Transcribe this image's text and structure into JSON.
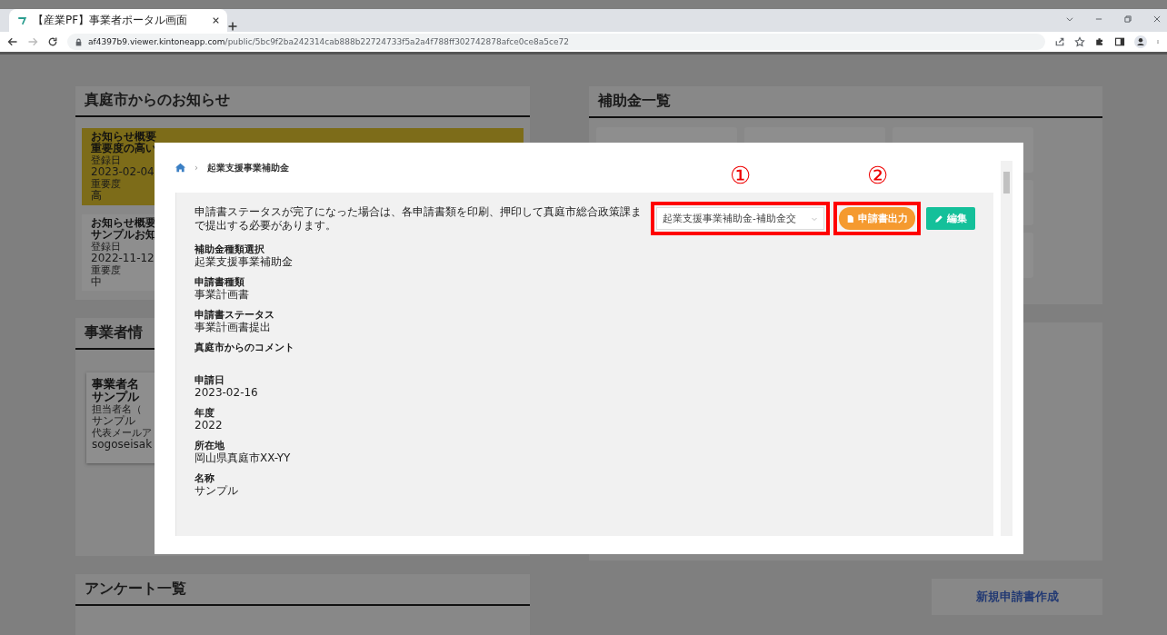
{
  "browser": {
    "tab_title": "【産業PF】事業者ポータル画面",
    "url_host": "af4397b9.viewer.kintoneapp.com",
    "url_path": "/public/5bc9f2ba242314cab888b22724733f5a2a4f788ff302742878afce0ce8a5ce72"
  },
  "notices_panel": {
    "title": "真庭市からのお知らせ",
    "items": [
      {
        "color": "#7d6c19",
        "lines": [
          "お知らせ概要",
          "重要度の高い"
        ],
        "date_label": "登録日",
        "date": "2023-02-04",
        "importance_label": "重要度",
        "importance": "高"
      },
      {
        "color": "#8e8e8e",
        "lines": [
          "お知らせ概要",
          "サンプルお知"
        ],
        "date_label": "登録日",
        "date": "2022-11-12",
        "importance_label": "重要度",
        "importance": "中"
      }
    ]
  },
  "business_panel": {
    "title": "事業者情",
    "card": {
      "name_label": "事業者名",
      "name": "サンプル",
      "contact_label": "担当者名（",
      "contact": "サンプル",
      "email_label": "代表メールア",
      "email": "sogoseisak"
    }
  },
  "survey_panel": {
    "title": "アンケート一覧"
  },
  "subsidy_panel": {
    "title": "補助金一覧"
  },
  "new_application_button": "新規申請書作成",
  "modal": {
    "breadcrumb_separator": "›",
    "breadcrumb": "起業支援事業補助金",
    "notice": "申請書ステータスが完了になった場合は、各申請書類を印刷、押印して真庭市総合政策課まで提出する必要があります。",
    "form_select": {
      "value": "起業支援事業補助金-補助金交"
    },
    "print_button": "申請書出力",
    "edit_button": "編集",
    "annotations": [
      "①",
      "②"
    ],
    "fields": [
      {
        "label": "補助金種類選択",
        "value": "起業支援事業補助金"
      },
      {
        "label": "申請書種類",
        "value": "事業計画書"
      },
      {
        "label": "申請書ステータス",
        "value": "事業計画書提出"
      },
      {
        "label": "真庭市からのコメント"
      },
      {
        "label": "申請日",
        "value": "2023-02-16"
      },
      {
        "label": "年度",
        "value": "2022"
      },
      {
        "label": "所在地",
        "value": "岡山県真庭市XX-YY"
      },
      {
        "label": "名称",
        "value": "サンプル"
      }
    ]
  }
}
